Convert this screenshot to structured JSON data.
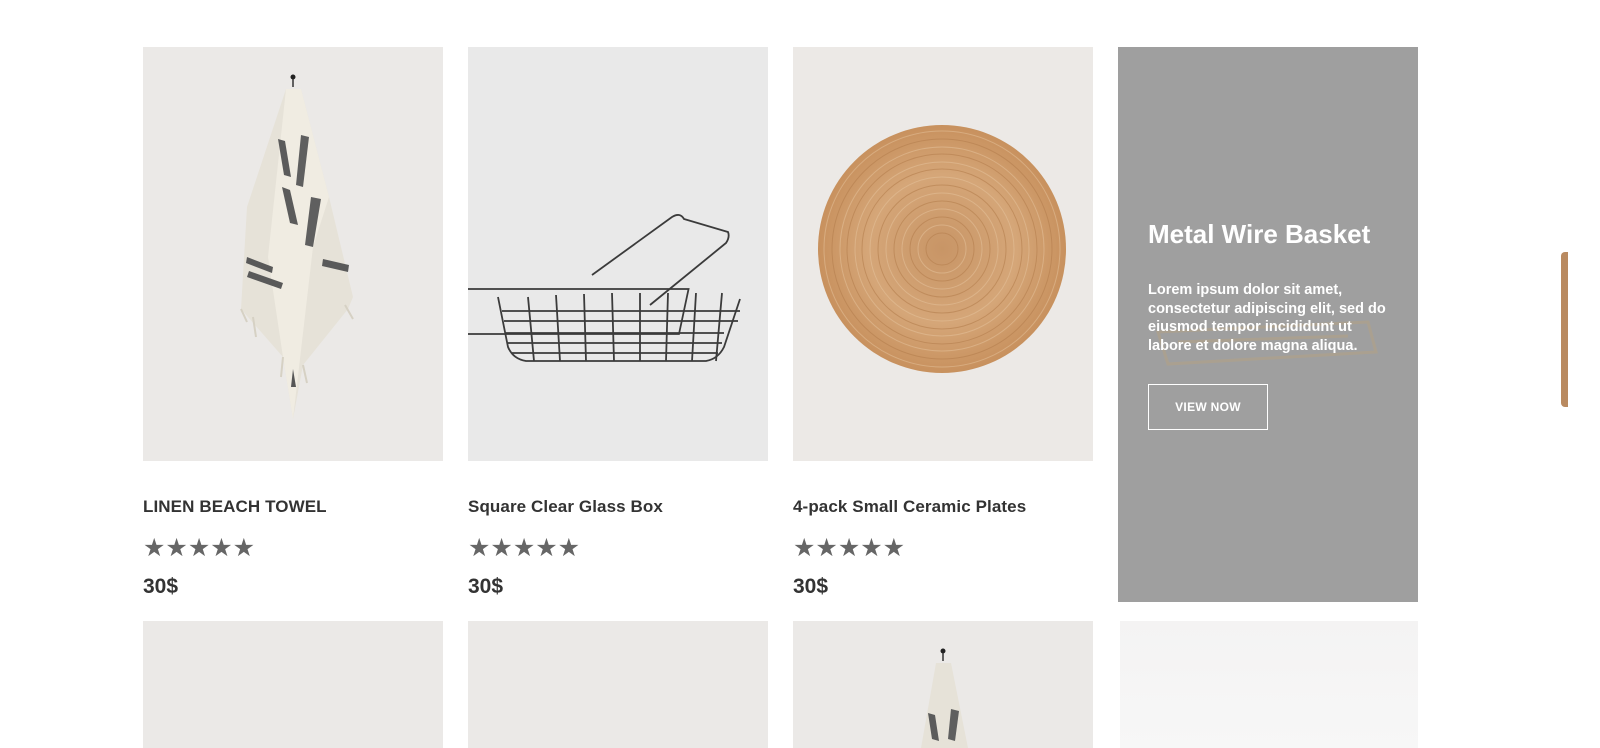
{
  "products": [
    {
      "title": "LINEN BEACH TOWEL",
      "stars": "★★★★★",
      "rating": 5,
      "price": "30$",
      "image": "striped-linen-towel"
    },
    {
      "title": "Square Clear Glass Box",
      "stars": "★★★★★",
      "rating": 5,
      "price": "30$",
      "image": "wire-basket"
    },
    {
      "title": "4-pack Small Ceramic Plates",
      "stars": "★★★★★",
      "rating": 5,
      "price": "30$",
      "image": "round-jute-placemat"
    }
  ],
  "promo": {
    "title": "Metal Wire Basket",
    "description": "Lorem ipsum dolor sit amet, consectetur adipiscing elit, sed do eiusmod tempor incididunt ut labore et dolore magna aliqua.",
    "button": "VIEW NOW"
  },
  "colors": {
    "promo_bg": "#9f9f9f",
    "star": "#666666",
    "scroll_indicator": "#b98a60",
    "text": "#333333"
  }
}
